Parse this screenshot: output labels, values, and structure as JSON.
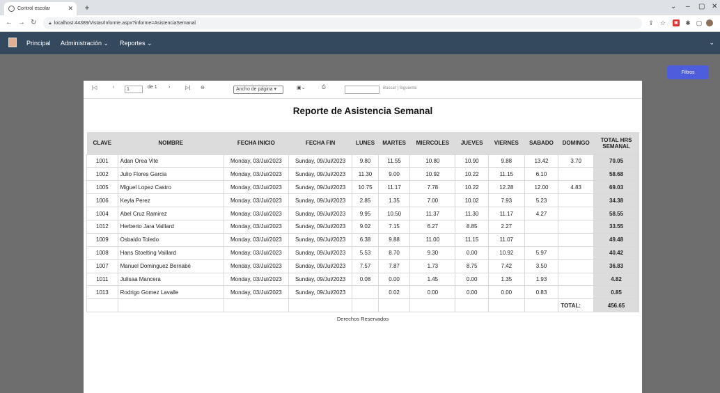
{
  "browser": {
    "tab_title": "Control escolar",
    "url": "localhost:44389/Vistas/Informe.aspx?informe=AsistenciaSemanal"
  },
  "nav": {
    "items": [
      "Principal",
      "Administración ⌄",
      "Reportes ⌄"
    ]
  },
  "filters_button": "Filtros",
  "toolbar": {
    "page_value": "1",
    "page_of": "de 1",
    "zoom": "Ancho de página ▾",
    "find_links": "Buscar | Siguiente"
  },
  "report": {
    "title": "Reporte de Asistencia Semanal",
    "columns": [
      "CLAVE",
      "NOMBRE",
      "FECHA INICIO",
      "FECHA FIN",
      "LUNES",
      "MARTES",
      "MIERCOLES",
      "JUEVES",
      "VIERNES",
      "SABADO",
      "DOMINGO",
      "TOTAL HRS SEMANAL"
    ],
    "rows": [
      [
        "1001",
        "Adan Orea Vite",
        "Monday, 03/Jul/2023",
        "Sunday, 09/Jul/2023",
        "9.80",
        "11.55",
        "10.80",
        "10.90",
        "9.88",
        "13.42",
        "3.70",
        "70.05"
      ],
      [
        "1002",
        "Julio Flores Garcia",
        "Monday, 03/Jul/2023",
        "Sunday, 09/Jul/2023",
        "11.30",
        "9.00",
        "10.92",
        "10.22",
        "11.15",
        "6.10",
        "",
        "58.68"
      ],
      [
        "1005",
        "Miguel Lopez Castro",
        "Monday, 03/Jul/2023",
        "Sunday, 09/Jul/2023",
        "10.75",
        "11.17",
        "7.78",
        "10.22",
        "12.28",
        "12.00",
        "4.83",
        "69.03"
      ],
      [
        "1006",
        "Keyla Perez",
        "Monday, 03/Jul/2023",
        "Sunday, 09/Jul/2023",
        "2.85",
        "1.35",
        "7.00",
        "10.02",
        "7.93",
        "5.23",
        "",
        "34.38"
      ],
      [
        "1004",
        "Abel Cruz Ramirez",
        "Monday, 03/Jul/2023",
        "Sunday, 09/Jul/2023",
        "9.95",
        "10.50",
        "11.37",
        "11.30",
        "11.17",
        "4.27",
        "",
        "58.55"
      ],
      [
        "1012",
        "Herberto Jara Vaillard",
        "Monday, 03/Jul/2023",
        "Sunday, 09/Jul/2023",
        "9.02",
        "7.15",
        "6.27",
        "8.85",
        "2.27",
        "",
        "",
        "33.55"
      ],
      [
        "1009",
        "Osbaldo Toledo",
        "Monday, 03/Jul/2023",
        "Sunday, 09/Jul/2023",
        "6.38",
        "9.88",
        "11.00",
        "11.15",
        "11.07",
        "",
        "",
        "49.48"
      ],
      [
        "1008",
        "Hans Stoelting Vaillard",
        "Monday, 03/Jul/2023",
        "Sunday, 09/Jul/2023",
        "5.53",
        "8.70",
        "9.30",
        "0.00",
        "10.92",
        "5.97",
        "",
        "40.42"
      ],
      [
        "1007",
        "Manuel Dominguez Bernabé",
        "Monday, 03/Jul/2023",
        "Sunday, 09/Jul/2023",
        "7.57",
        "7.87",
        "1.73",
        "8.75",
        "7.42",
        "3.50",
        "",
        "36.83"
      ],
      [
        "1011",
        "Julisaa Mancera",
        "Monday, 03/Jul/2023",
        "Sunday, 09/Jul/2023",
        "0.08",
        "0.00",
        "1.45",
        "0.00",
        "1.35",
        "1.93",
        "",
        "4.82"
      ],
      [
        "1013",
        "Rodrigo Gomez Lavalle",
        "Monday, 03/Jul/2023",
        "Sunday, 09/Jul/2023",
        "",
        "0.02",
        "0.00",
        "0.00",
        "0.00",
        "0.83",
        "",
        "0.85"
      ]
    ],
    "total_label": "TOTAL:",
    "total_value": "456.65",
    "footer": "Derechos Reservados"
  }
}
